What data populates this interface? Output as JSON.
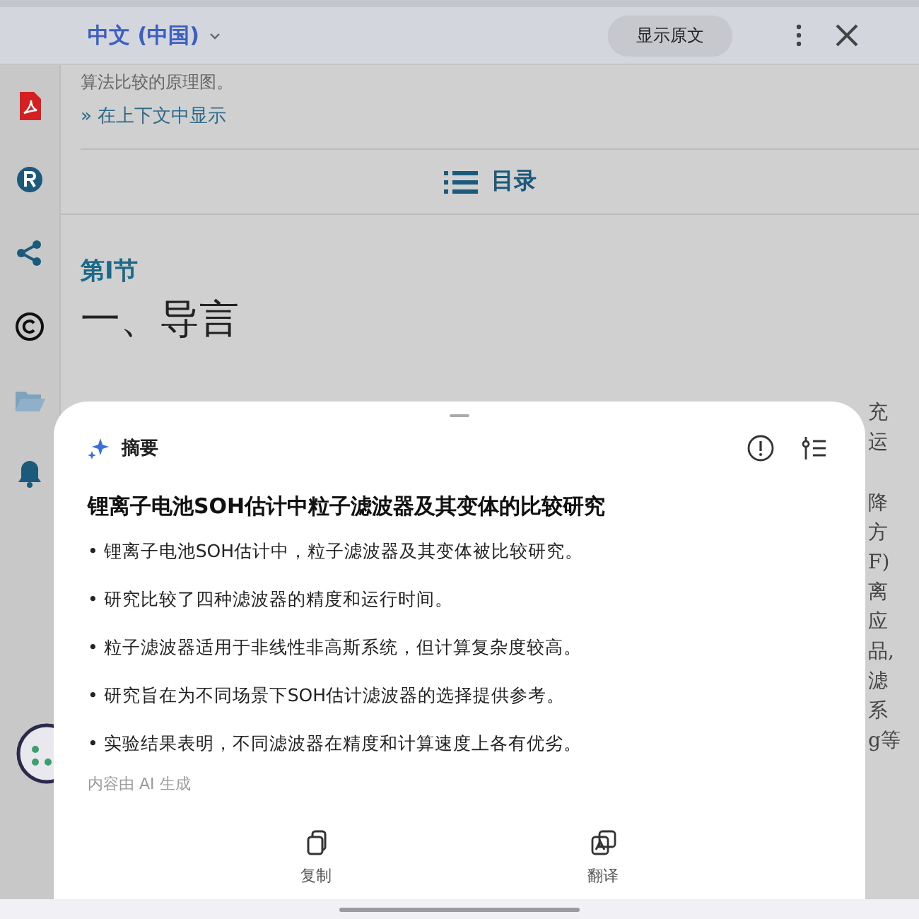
{
  "top_bar": {
    "language": "中文 (中国)",
    "show_original_button": "显示原文"
  },
  "page": {
    "caption": "算法比较的原理图。",
    "context_link": "» 在上下文中显示",
    "toc_button": "目录",
    "section_label": "第I节",
    "section_title": "一、导言",
    "side_text": [
      [
        "充",
        "运"
      ],
      [
        "降",
        "方",
        "F)",
        "离",
        "应",
        "品,",
        "滤",
        "系",
        "g等"
      ]
    ]
  },
  "summary_sheet": {
    "header": "摘要",
    "title": "锂离子电池SOH估计中粒子滤波器及其变体的比较研究",
    "bullets": [
      "• 锂离子电池SOH估计中，粒子滤波器及其变体被比较研究。",
      "• 研究比较了四种滤波器的精度和运行时间。",
      "• 粒子滤波器适用于非线性非高斯系统，但计算复杂度较高。",
      "• 研究旨在为不同场景下SOH估计滤波器的选择提供参考。",
      "• 实验结果表明，不同滤波器在精度和计算速度上各有优劣。"
    ],
    "note": "内容由 AI 生成",
    "actions": [
      {
        "kind": "copy",
        "label": "复制"
      },
      {
        "kind": "translate",
        "label": "翻译"
      }
    ]
  }
}
